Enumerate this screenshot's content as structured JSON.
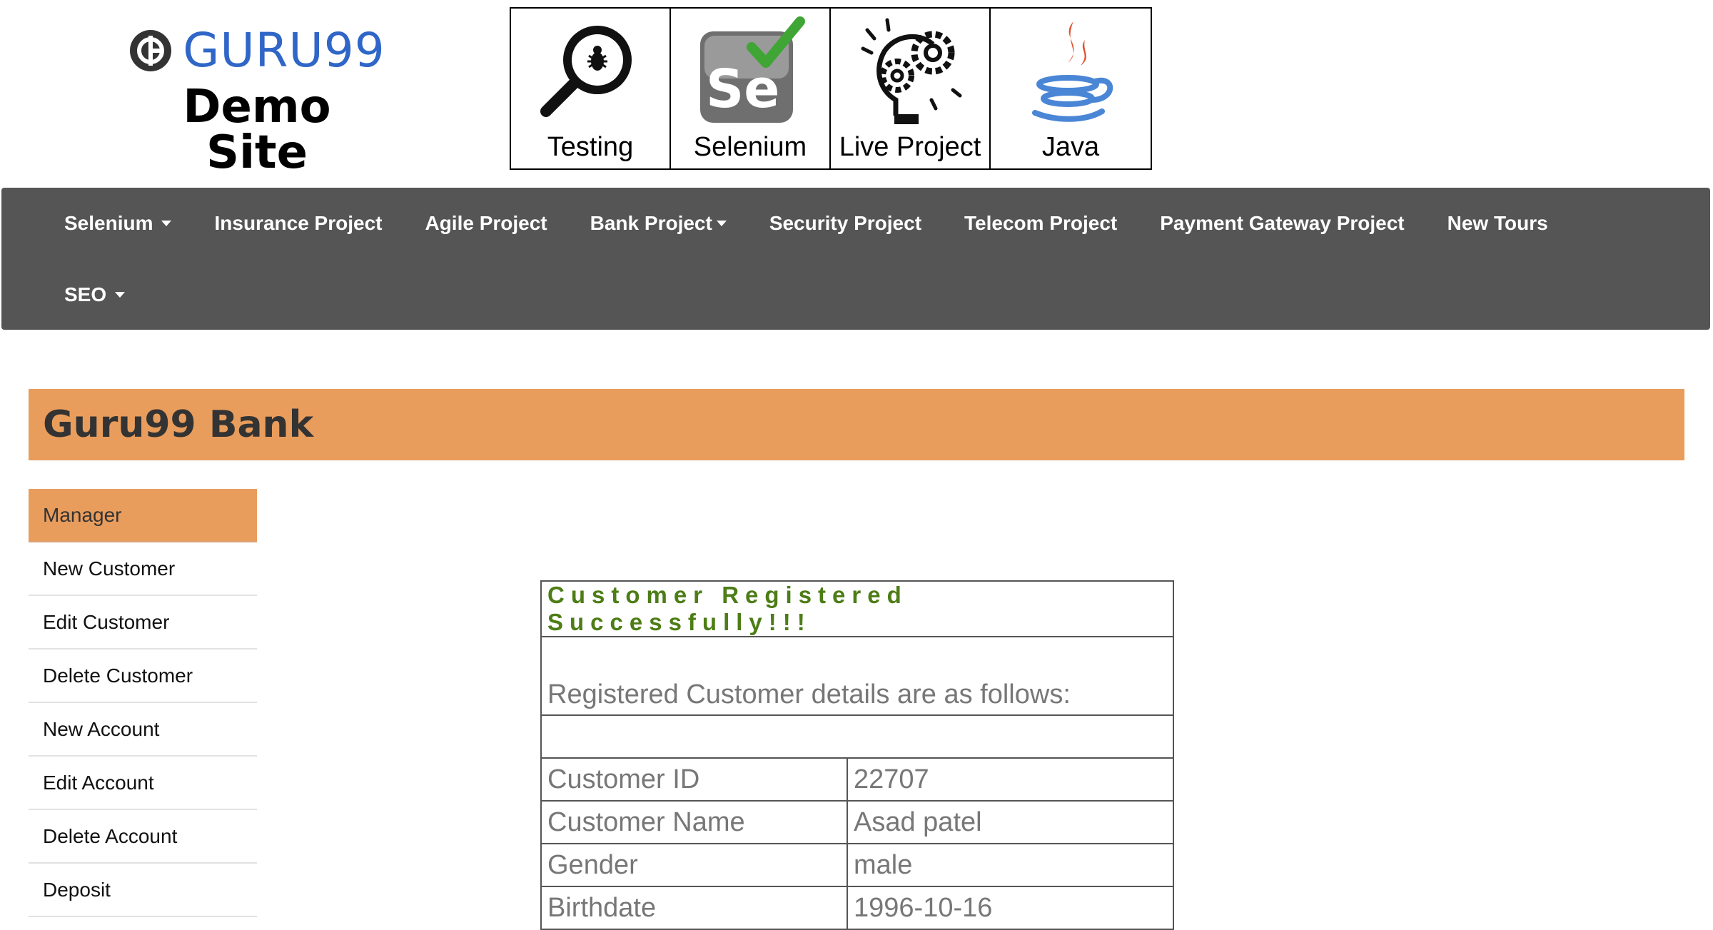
{
  "header": {
    "logo_text": "GURU99",
    "logo_subtitle": "Demo Site",
    "tiles": [
      {
        "label": "Testing",
        "icon": "magnifier-bug-icon"
      },
      {
        "label": "Selenium",
        "icon": "selenium-se-icon"
      },
      {
        "label": "Live Project",
        "icon": "lightbulb-gears-icon"
      },
      {
        "label": "Java",
        "icon": "java-cup-icon"
      }
    ]
  },
  "nav": {
    "row1": [
      {
        "label": "Selenium",
        "dropdown": true
      },
      {
        "label": "Insurance Project"
      },
      {
        "label": "Agile Project"
      },
      {
        "label": "Bank Project",
        "dropdown": true
      },
      {
        "label": "Security Project"
      },
      {
        "label": "Telecom Project"
      },
      {
        "label": "Payment Gateway Project"
      },
      {
        "label": "New Tours"
      }
    ],
    "row2": [
      {
        "label": "SEO",
        "dropdown": true
      }
    ]
  },
  "bank": {
    "title": "Guru99 Bank"
  },
  "sidebar": {
    "items": [
      {
        "label": "Manager"
      },
      {
        "label": "New Customer"
      },
      {
        "label": "Edit Customer"
      },
      {
        "label": "Delete Customer"
      },
      {
        "label": "New Account"
      },
      {
        "label": "Edit Account"
      },
      {
        "label": "Delete Account"
      },
      {
        "label": "Deposit"
      }
    ]
  },
  "result": {
    "message": "Customer Registered Successfully!!!",
    "subtitle": "Registered Customer details are as follows:",
    "rows": [
      {
        "key": "Customer ID",
        "value": "22707"
      },
      {
        "key": "Customer Name",
        "value": "Asad patel"
      },
      {
        "key": "Gender",
        "value": "male"
      },
      {
        "key": "Birthdate",
        "value": "1996-10-16"
      }
    ]
  },
  "colors": {
    "nav_bg": "#555555",
    "accent_orange": "#e99d5c",
    "logo_blue": "#2f66c7",
    "success_green": "#4d7d16"
  }
}
